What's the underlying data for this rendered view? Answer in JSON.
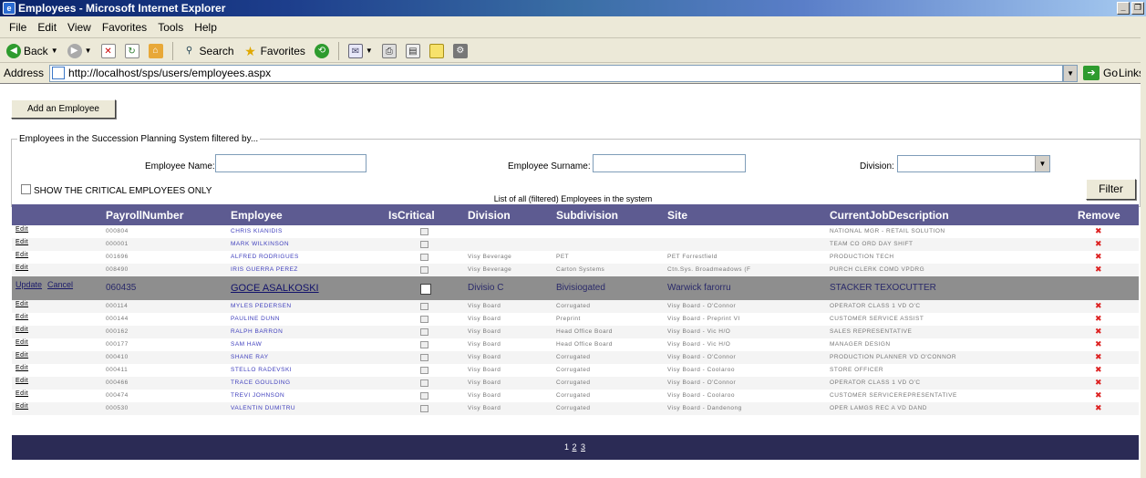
{
  "window": {
    "title": "Employees - Microsoft Internet Explorer",
    "min": "_",
    "restore": "❐"
  },
  "menu": [
    "File",
    "Edit",
    "View",
    "Favorites",
    "Tools",
    "Help"
  ],
  "toolbar": {
    "back": "Back",
    "search": "Search",
    "favorites": "Favorites"
  },
  "address": {
    "label": "Address",
    "url": "http://localhost/sps/users/employees.aspx",
    "go": "Go",
    "links": "Links"
  },
  "page": {
    "add_button": "Add an Employee",
    "filter_legend": "Employees in the Succession Planning System filtered by...",
    "employee_name_label": "Employee Name:",
    "employee_surname_label": "Employee Surname:",
    "division_label": "Division:",
    "critical_only_label": "SHOW THE CRITICAL EMPLOYEES ONLY",
    "filter_button": "Filter",
    "grid_caption": "List of all (filtered) Employees in the system"
  },
  "grid": {
    "headers": [
      "PayrollNumber",
      "Employee",
      "IsCritical",
      "Division",
      "Subdivision",
      "Site",
      "CurrentJobDescription",
      "Remove"
    ],
    "rows_top": [
      {
        "edit": "Edit",
        "payroll": "000804",
        "employee": "CHRIS KIANIDIS",
        "division": "",
        "subdivision": "",
        "site": "",
        "job": "NATIONAL MGR - RETAIL SOLUTION"
      },
      {
        "edit": "Edit",
        "payroll": "000001",
        "employee": "MARK WILKINSON",
        "division": "",
        "subdivision": "",
        "site": "",
        "job": "TEAM CO ORD DAY SHIFT"
      },
      {
        "edit": "Edit",
        "payroll": "001696",
        "employee": "ALFRED RODRIGUES",
        "division": "Visy Beverage",
        "subdivision": "PET",
        "site": "PET Forrestfield",
        "job": "PRODUCTION TECH"
      },
      {
        "edit": "Edit",
        "payroll": "008490",
        "employee": "IRIS GUERRA PEREZ",
        "division": "Visy Beverage",
        "subdivision": "Carton Systems",
        "site": "Ctn.Sys. Broadmeadows (F",
        "job": "PURCH CLERK COMD VPDRG"
      }
    ],
    "edit_row": {
      "update": "Update",
      "cancel": "Cancel",
      "payroll": "060435",
      "employee": "GOCE ASALKOSKI",
      "division": "Divisio C",
      "subdivision": "Bivisiogated",
      "site": "Warwick farorru",
      "job": "STACKER TEXOCUTTER"
    },
    "rows_bottom": [
      {
        "edit": "Edit",
        "payroll": "000114",
        "employee": "MYLES PEDERSEN",
        "division": "Visy Board",
        "subdivision": "Corrugated",
        "site": "Visy Board - O'Connor",
        "job": "OPERATOR CLASS 1 VD O'C"
      },
      {
        "edit": "Edit",
        "payroll": "000144",
        "employee": "PAULINE DUNN",
        "division": "Visy Board",
        "subdivision": "Preprint",
        "site": "Visy Board - Preprint VI",
        "job": "CUSTOMER SERVICE ASSIST"
      },
      {
        "edit": "Edit",
        "payroll": "000162",
        "employee": "RALPH BARRON",
        "division": "Visy Board",
        "subdivision": "Head Office Board",
        "site": "Visy Board - Vic H/O",
        "job": "SALES REPRESENTATIVE"
      },
      {
        "edit": "Edit",
        "payroll": "000177",
        "employee": "SAM HAW",
        "division": "Visy Board",
        "subdivision": "Head Office Board",
        "site": "Visy Board - Vic H/O",
        "job": "MANAGER DESIGN"
      },
      {
        "edit": "Edit",
        "payroll": "000410",
        "employee": "SHANE RAY",
        "division": "Visy Board",
        "subdivision": "Corrugated",
        "site": "Visy Board - O'Connor",
        "job": "PRODUCTION PLANNER VD O'CONNOR"
      },
      {
        "edit": "Edit",
        "payroll": "000411",
        "employee": "STELLO RADEVSKI",
        "division": "Visy Board",
        "subdivision": "Corrugated",
        "site": "Visy Board - Coolaroo",
        "job": "STORE OFFICER"
      },
      {
        "edit": "Edit",
        "payroll": "000466",
        "employee": "TRACE GOULDING",
        "division": "Visy Board",
        "subdivision": "Corrugated",
        "site": "Visy Board - O'Connor",
        "job": "OPERATOR CLASS 1 VD O'C"
      },
      {
        "edit": "Edit",
        "payroll": "000474",
        "employee": "TREVI JOHNSON",
        "division": "Visy Board",
        "subdivision": "Corrugated",
        "site": "Visy Board - Coolaroo",
        "job": "CUSTOMER SERVICEREPRESENTATIVE"
      },
      {
        "edit": "Edit",
        "payroll": "000530",
        "employee": "VALENTIN DUMITRU",
        "division": "Visy Board",
        "subdivision": "Corrugated",
        "site": "Visy Board - Dandenong",
        "job": "OPER LAMGS REC A VD DAND"
      }
    ],
    "remove_icon": "✖"
  },
  "pager": [
    "1",
    "2",
    "3"
  ]
}
